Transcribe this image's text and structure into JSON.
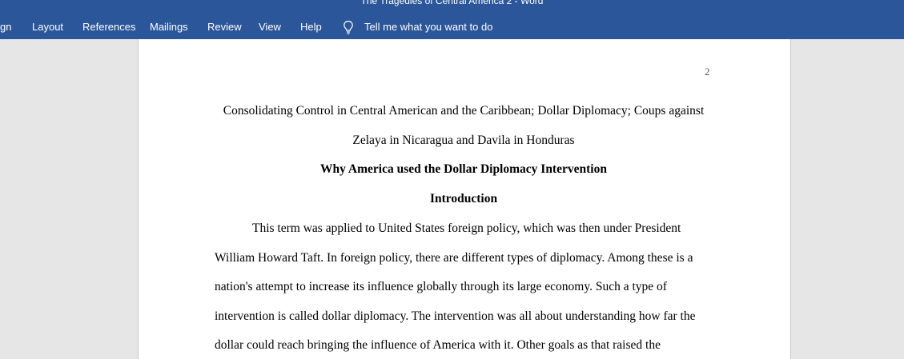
{
  "window": {
    "title": "The Tragedies of Central America 2  -  Word"
  },
  "ribbon": {
    "tabs": [
      {
        "label": "gn"
      },
      {
        "label": "Layout"
      },
      {
        "label": "References"
      },
      {
        "label": "Mailings"
      },
      {
        "label": "Review"
      },
      {
        "label": "View"
      },
      {
        "label": "Help"
      }
    ],
    "tell_me": {
      "label": "Tell me what you want to do",
      "icon": "lightbulb-icon"
    }
  },
  "document": {
    "page_number": "2",
    "title_line_1": "Consolidating Control in Central American and the Caribbean; Dollar Diplomacy; Coups against",
    "title_line_2": "Zelaya in Nicaragua and Davila in Honduras",
    "heading_1": "Why America used the Dollar Diplomacy Intervention",
    "heading_2": "Introduction",
    "paragraph_lines": [
      "This term was applied to United States foreign policy, which was then under President",
      "William Howard Taft. In foreign policy, there are different types of diplomacy. Among these is a",
      "nation's attempt to increase its influence globally through its large economy. Such a type of",
      "intervention is called dollar diplomacy. The intervention was all about understanding how far the",
      "dollar could reach bringing the influence of America with it. Other goals as that raised the"
    ]
  },
  "colors": {
    "ribbon": "#2b579a",
    "workspace": "#e6e6e6",
    "page": "#ffffff"
  }
}
